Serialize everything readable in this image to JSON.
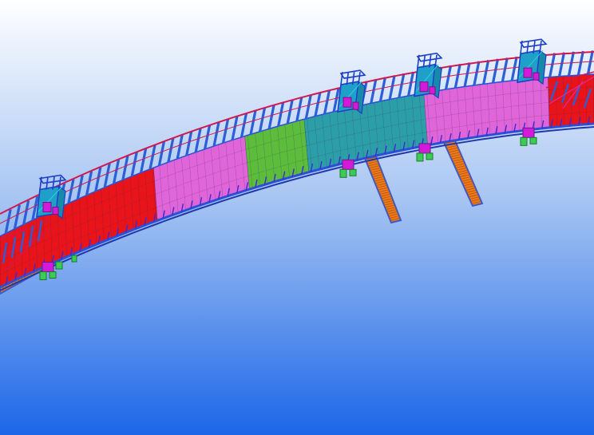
{
  "scene": {
    "background": {
      "top_color": "#ffffff",
      "bottom_color": "#1c66e8"
    },
    "colors": {
      "edge": "#2b4fd8",
      "chord": "#d0194f",
      "post": "#2a5fd6",
      "deck_red": "#e8141a",
      "deck_magenta": "#e065d8",
      "deck_green": "#5cbc3c",
      "deck_teal": "#2c9ea8",
      "stair": "#ec7a1a",
      "stair_edge": "#3a58d0",
      "tower": "#1fa0c8",
      "tower_edge": "#1c3fc8",
      "joint": "#d21ad8",
      "support": "#3ccb54"
    },
    "deck_segments": [
      {
        "id": "seg-red-1",
        "color": "deck_red"
      },
      {
        "id": "seg-magenta-1",
        "color": "deck_magenta"
      },
      {
        "id": "seg-green",
        "color": "deck_green"
      },
      {
        "id": "seg-teal",
        "color": "deck_teal"
      },
      {
        "id": "seg-magenta-2",
        "color": "deck_magenta"
      },
      {
        "id": "seg-red-2",
        "color": "deck_red"
      }
    ],
    "towers": [
      "tower-west",
      "tower-center-1",
      "tower-center-2",
      "tower-east"
    ],
    "stair_flights": [
      "stair-west",
      "stair-down-1",
      "stair-down-2",
      "stair-east"
    ]
  }
}
